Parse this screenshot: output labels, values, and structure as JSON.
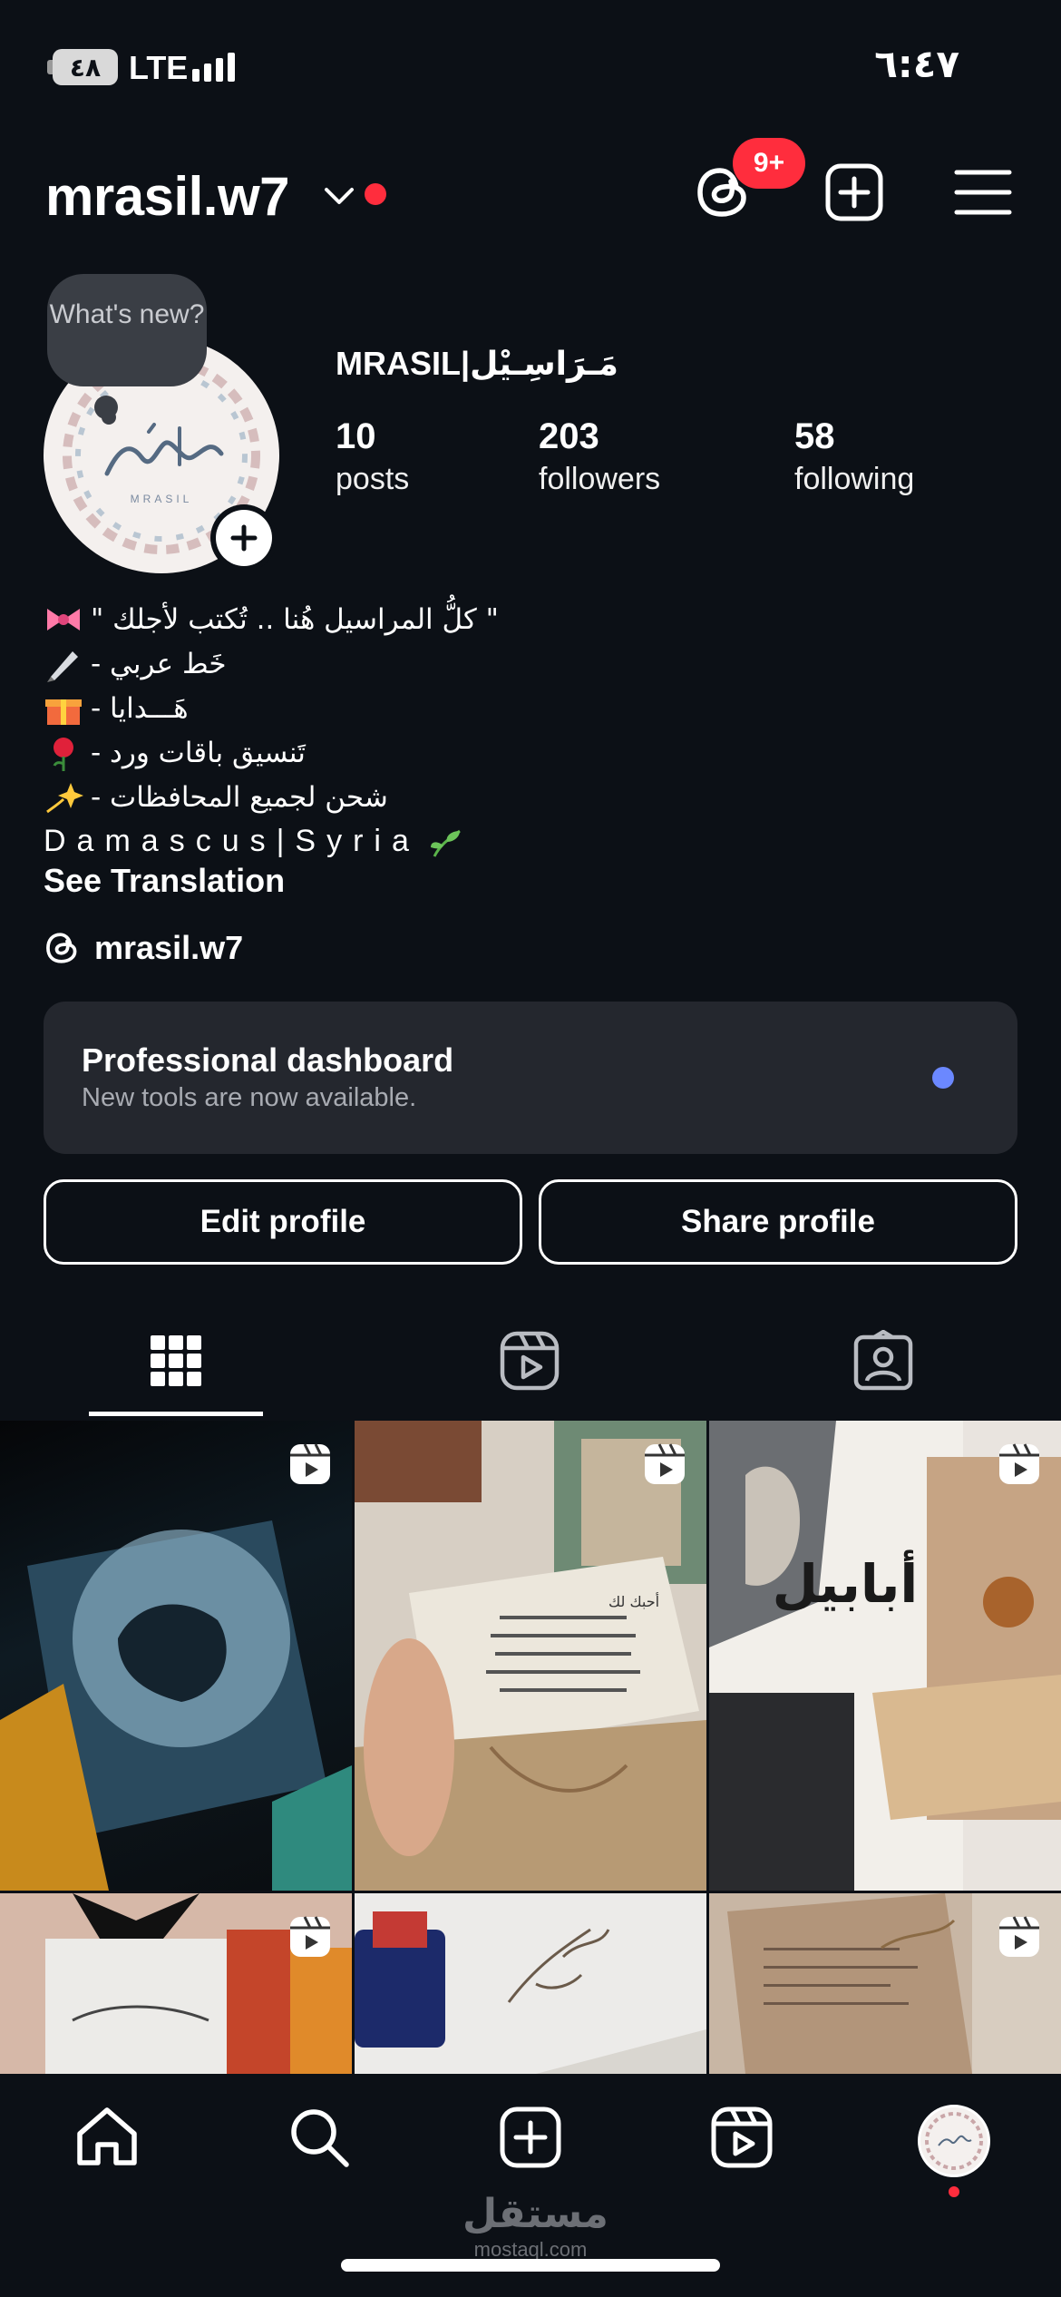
{
  "status_bar": {
    "battery": "٤٨",
    "network": "LTE",
    "time": "٦:٤٧"
  },
  "header": {
    "username": "mrasil.w7",
    "threads_badge": "9+"
  },
  "profile": {
    "story_bubble": "What's new?",
    "display_name": "MRASIL|مَـرَاسِـيْل",
    "stats": [
      {
        "value": "10",
        "label": "posts"
      },
      {
        "value": "203",
        "label": "followers"
      },
      {
        "value": "58",
        "label": "following"
      }
    ]
  },
  "bio": {
    "lines": [
      {
        "text": "\" كلُّ المراسيل هُنا .. تُكتب لأجلك \"",
        "icon": "ribbon-icon"
      },
      {
        "text": "- خَط عربي",
        "icon": "pen-icon"
      },
      {
        "text": "- هَـــدايا",
        "icon": "gift-icon"
      },
      {
        "text": "- تَنسيق باقات ورد",
        "icon": "rose-icon"
      },
      {
        "text": "- شحن لجميع المحافظات",
        "icon": "sparkle-icon"
      }
    ],
    "location": "Damascus|Syria",
    "location_icon": "seedling-icon",
    "see_translation": "See Translation",
    "threads_link": "mrasil.w7"
  },
  "dashboard": {
    "title": "Professional dashboard",
    "subtitle": "New tools are now available."
  },
  "buttons": {
    "edit": "Edit profile",
    "share": "Share profile"
  },
  "tabs": [
    "grid-icon",
    "reels-icon",
    "tagged-icon"
  ],
  "grid": {
    "book_title": "أبابيل",
    "note_text": "أحبك لك"
  },
  "bottom_nav": [
    "home-icon",
    "search-icon",
    "create-icon",
    "reels-icon",
    "profile-avatar"
  ],
  "watermark": {
    "arabic": "مستقل",
    "latin": "mostaql.com"
  },
  "colors": {
    "background": "#0c1016",
    "card": "#24272e",
    "notification": "#ff2d3d",
    "accent_dot": "#6b88ff"
  }
}
